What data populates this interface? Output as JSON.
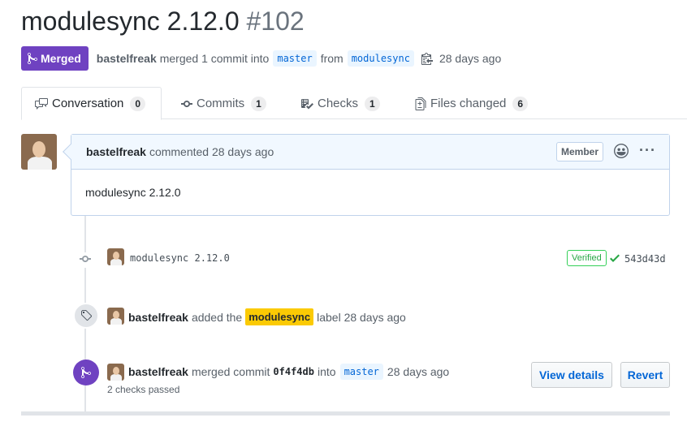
{
  "pr": {
    "title": "modulesync 2.12.0",
    "number": "#102",
    "state": "Merged",
    "author": "bastelfreak",
    "merged_text": "merged 1 commit into",
    "base_branch": "master",
    "from_text": "from",
    "head_branch": "modulesync",
    "time": "28 days ago"
  },
  "tabs": [
    {
      "label": "Conversation",
      "count": "0",
      "icon": "comment-discussion-icon",
      "selected": true
    },
    {
      "label": "Commits",
      "count": "1",
      "icon": "git-commit-icon"
    },
    {
      "label": "Checks",
      "count": "1",
      "icon": "checklist-icon"
    },
    {
      "label": "Files changed",
      "count": "6",
      "icon": "file-diff-icon"
    }
  ],
  "comment": {
    "author": "bastelfreak",
    "action": "commented 28 days ago",
    "role": "Member",
    "body": "modulesync 2.12.0"
  },
  "commit": {
    "message": "modulesync 2.12.0",
    "verified": "Verified",
    "sha": "543d43d"
  },
  "label_event": {
    "author": "bastelfreak",
    "pre": "added the",
    "label": "modulesync",
    "label_color": "#fbca04",
    "post": "label 28 days ago"
  },
  "merge_event": {
    "author": "bastelfreak",
    "pre": "merged commit",
    "sha": "0f4f4db",
    "into": "into",
    "branch": "master",
    "time": "28 days ago",
    "checks": "2 checks passed",
    "view_details": "View details",
    "revert": "Revert"
  },
  "colors": {
    "merged": "#6f42c1",
    "link": "#0366d6",
    "verified": "#28a745"
  }
}
